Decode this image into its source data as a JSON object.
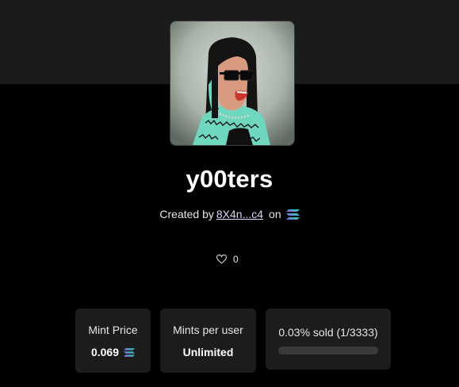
{
  "collection": {
    "title": "y00ters",
    "created_by_label": "Created by",
    "creator_address": "8X4n...c4",
    "on_label": "on",
    "chain_icon": "solana-icon",
    "like_count": "0",
    "like_icon": "heart-outline-icon"
  },
  "stats": {
    "mint_price": {
      "label": "Mint Price",
      "value": "0.069",
      "currency_icon": "solana-icon"
    },
    "mints_per_user": {
      "label": "Mints per user",
      "value": "Unlimited"
    },
    "sold": {
      "label": "0.03% sold (1/3333)",
      "minted": 1,
      "supply": 3333,
      "fraction": 0.0003
    }
  },
  "colors": {
    "background": "#000000",
    "header_band": "#1b1b1b",
    "card_background": "#1c1c1c",
    "progress_track": "#3a3a3a",
    "solana_gradient": [
      "#9945FF",
      "#14F195"
    ]
  }
}
